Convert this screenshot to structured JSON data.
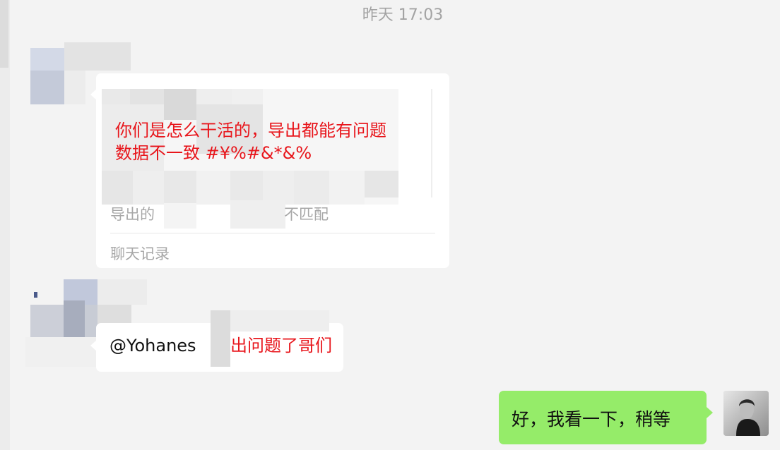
{
  "timestamp": "昨天 17:03",
  "messages": {
    "first": {
      "quoted_title": "你们是怎么干活的，导出都能有问题",
      "quoted_line2": "数据不一致 #¥%#&*&%",
      "preview_prefix": "导出的",
      "preview_suffix": "不匹配",
      "card_footer": "聊天记录"
    },
    "second": {
      "mention": "@Yohanes",
      "text": "出问题了哥们"
    },
    "reply": {
      "text": "好，我看一下，稍等"
    }
  },
  "colors": {
    "background": "#f3f3f3",
    "bubble_white": "#ffffff",
    "bubble_green": "#95ec69",
    "red_text": "#e8151b",
    "gray_text": "#a7a7a7"
  },
  "icons": {
    "sender_avatar": "pixelated-avatar",
    "self_avatar": "profile-photo"
  }
}
